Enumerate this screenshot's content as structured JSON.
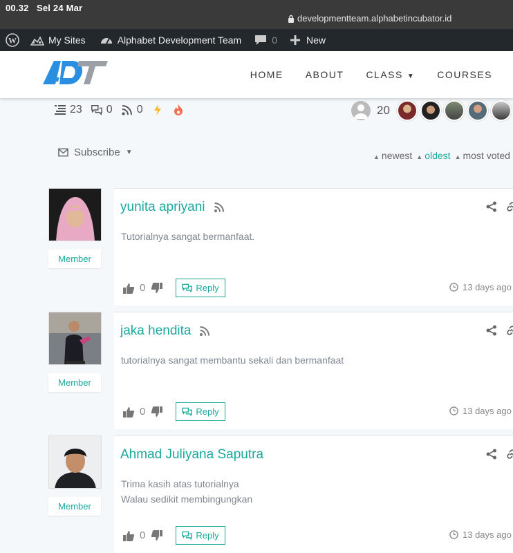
{
  "status_bar": {
    "time": "00.32",
    "date": "Sel 24 Mar",
    "url": "developmentteam.alphabetincubator.id"
  },
  "admin_bar": {
    "my_sites": "My Sites",
    "site_name": "Alphabet Development Team",
    "comments_count": "0",
    "new_label": "New"
  },
  "header": {
    "nav": [
      "HOME",
      "ABOUT",
      "CLASS",
      "COURSES"
    ]
  },
  "stats": {
    "threads": "23",
    "replies": "0",
    "followers": "0",
    "participants": "20"
  },
  "toolbar": {
    "subscribe": "Subscribe",
    "sort_newest": "newest",
    "sort_oldest": "oldest",
    "sort_most_voted": "most voted"
  },
  "comments": [
    {
      "author": "yunita apriyani",
      "text": [
        "Tutorialnya sangat bermanfaat."
      ],
      "badge": "Member",
      "votes": "0",
      "reply": "Reply",
      "date": "13 days ago"
    },
    {
      "author": "jaka hendita",
      "text": [
        "tutorialnya sangat membantu sekali dan bermanfaat"
      ],
      "badge": "Member",
      "votes": "0",
      "reply": "Reply",
      "date": "13 days ago"
    },
    {
      "author": "Ahmad Juliyana Saputra",
      "text": [
        "Trima kasih atas tutorialnya",
        "Walau sedikit membingungkan"
      ],
      "badge": "Member",
      "votes": "0",
      "reply": "Reply",
      "date": "13 days ago"
    }
  ],
  "colors": {
    "accent": "#19a99b",
    "admin_bar": "#23282d",
    "logo_blue": "#2a8fe0"
  }
}
